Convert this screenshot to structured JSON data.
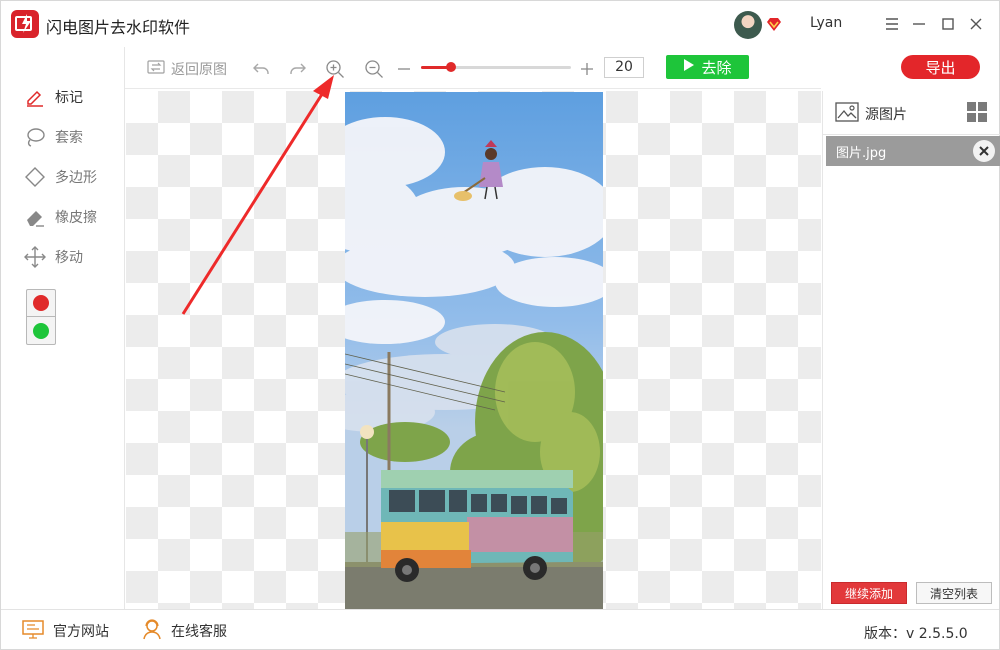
{
  "window": {
    "title": "闪电图片去水印软件",
    "user_name": "Lyan"
  },
  "toolbar": {
    "restore_label": "返回原图",
    "zoom_value": "20",
    "zoom_slider_fraction": 0.2,
    "remove_label": "去除",
    "export_label": "导出"
  },
  "tools": [
    {
      "label": "标记",
      "icon": "marker-icon"
    },
    {
      "label": "套索",
      "icon": "lasso-icon"
    },
    {
      "label": "多边形",
      "icon": "polygon-icon"
    },
    {
      "label": "橡皮擦",
      "icon": "eraser-icon"
    },
    {
      "label": "移动",
      "icon": "move-icon"
    }
  ],
  "colors": {
    "red": "#e02a2a",
    "green": "#1ec53a",
    "accent": "#e3262a"
  },
  "right_panel": {
    "title": "源图片",
    "files": [
      {
        "name": "图片.jpg"
      }
    ],
    "add_more_label": "继续添加",
    "clear_label": "清空列表"
  },
  "statusbar": {
    "website_label": "官方网站",
    "support_label": "在线客服",
    "version": "版本：v 2.5.5.0"
  }
}
